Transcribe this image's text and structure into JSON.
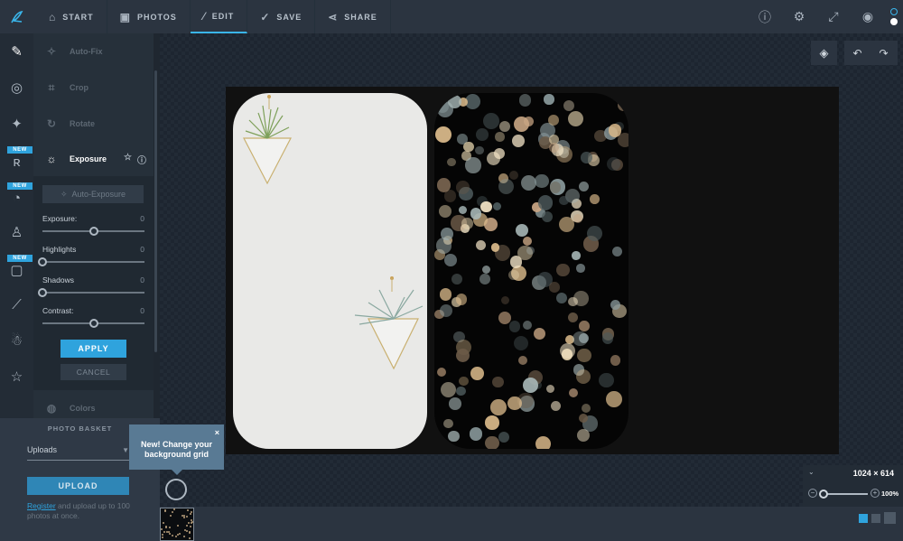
{
  "nav": {
    "items": [
      {
        "label": "START",
        "icon": "home-icon"
      },
      {
        "label": "PHOTOS",
        "icon": "image-icon"
      },
      {
        "label": "EDIT",
        "icon": "magic-wand-icon"
      },
      {
        "label": "SAVE",
        "icon": "check-circle-icon"
      },
      {
        "label": "SHARE",
        "icon": "share-icon"
      }
    ],
    "active": "EDIT"
  },
  "rail": {
    "badges": [
      "NEW",
      "NEW",
      "NEW"
    ]
  },
  "tools": {
    "auto_fix": "Auto-Fix",
    "crop": "Crop",
    "rotate": "Rotate",
    "exposure": "Exposure",
    "colors": "Colors"
  },
  "exposure_panel": {
    "auto_button": "Auto-Exposure",
    "sliders": [
      {
        "label": "Exposure:",
        "value": "0",
        "level": 0.5
      },
      {
        "label": "Highlights",
        "value": "0",
        "level": 0.0
      },
      {
        "label": "Shadows",
        "value": "0",
        "level": 0.0
      },
      {
        "label": "Contrast:",
        "value": "0",
        "level": 0.5
      }
    ],
    "apply": "APPLY",
    "cancel": "CANCEL"
  },
  "basket": {
    "title": "PHOTO BASKET",
    "select_value": "Uploads",
    "upload": "UPLOAD",
    "register_link": "Register",
    "register_text": " and upload up to 100 photos at once."
  },
  "tooltip": {
    "text": "New! Change your background grid",
    "close": "×"
  },
  "zoom": {
    "dimensions": "1024 × 614",
    "percent": "100%",
    "level": 0.0
  },
  "colors": {
    "accent": "#2fa3dd",
    "topbar": "#2b3440"
  }
}
